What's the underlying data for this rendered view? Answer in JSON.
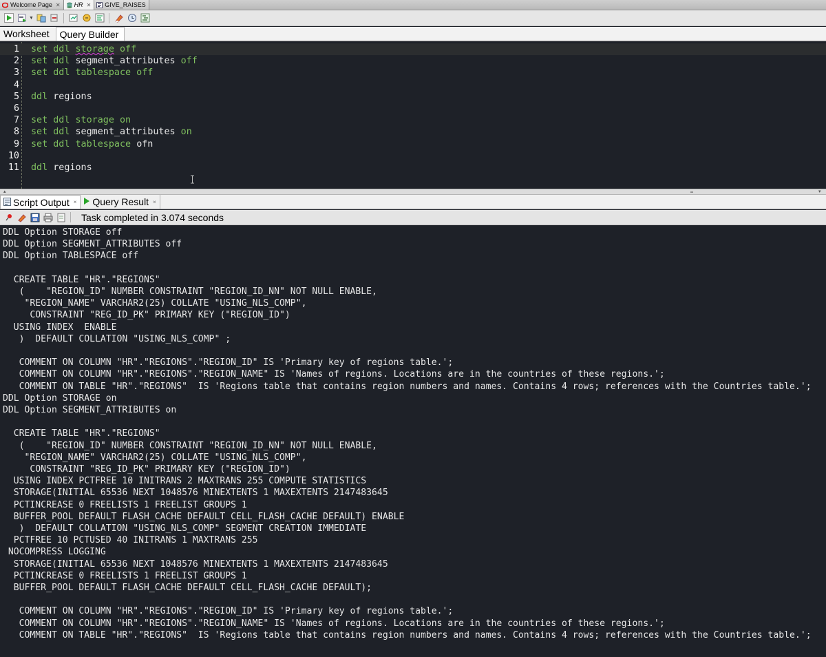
{
  "doc_tabs": [
    {
      "label": "Welcome Page",
      "icon": "oracle-icon",
      "italic": false,
      "active": false
    },
    {
      "label": "HR",
      "icon": "database-connection-icon",
      "italic": true,
      "active": true
    },
    {
      "label": "GIVE_RAISES",
      "icon": "procedure-icon",
      "italic": false,
      "active": false
    }
  ],
  "toolbar": {
    "buttons": [
      "run-statement-icon",
      "run-script-icon",
      "commit-icon",
      "rollback-icon",
      "tuning-icon",
      "autotrace-icon",
      "explain-plan-icon",
      "clear-icon",
      "history-icon",
      "format-icon"
    ]
  },
  "sub_tabs": {
    "worksheet": "Worksheet",
    "query_builder": "Query Builder"
  },
  "editor": {
    "lines": [
      {
        "n": "1",
        "parts": [
          [
            "kw",
            "set ddl "
          ],
          [
            "sq",
            "storage"
          ],
          [
            "kw",
            " off"
          ]
        ]
      },
      {
        "n": "2",
        "parts": [
          [
            "kw",
            "set ddl "
          ],
          [
            "id",
            "segment_attributes"
          ],
          [
            "kw",
            " off"
          ]
        ]
      },
      {
        "n": "3",
        "parts": [
          [
            "kw",
            "set ddl tablespace off"
          ]
        ]
      },
      {
        "n": "4",
        "parts": []
      },
      {
        "n": "5",
        "parts": [
          [
            "kw",
            "ddl "
          ],
          [
            "id",
            "regions"
          ]
        ]
      },
      {
        "n": "6",
        "parts": []
      },
      {
        "n": "7",
        "parts": [
          [
            "kw",
            "set ddl storage on"
          ]
        ]
      },
      {
        "n": "8",
        "parts": [
          [
            "kw",
            "set ddl "
          ],
          [
            "id",
            "segment_attributes"
          ],
          [
            "kw",
            " on"
          ]
        ]
      },
      {
        "n": "9",
        "parts": [
          [
            "kw",
            "set ddl tablespace "
          ],
          [
            "id",
            "ofn"
          ]
        ]
      },
      {
        "n": "10",
        "parts": []
      },
      {
        "n": "11",
        "parts": [
          [
            "kw",
            "ddl "
          ],
          [
            "id",
            "regions"
          ]
        ]
      }
    ]
  },
  "output_tabs": {
    "script_output": "Script Output",
    "query_result": "Query Result"
  },
  "status": "Task completed in 3.074 seconds",
  "output_lines": [
    "DDL Option STORAGE off",
    "DDL Option SEGMENT_ATTRIBUTES off",
    "DDL Option TABLESPACE off",
    "",
    "  CREATE TABLE \"HR\".\"REGIONS\"",
    "   (    \"REGION_ID\" NUMBER CONSTRAINT \"REGION_ID_NN\" NOT NULL ENABLE,",
    "    \"REGION_NAME\" VARCHAR2(25) COLLATE \"USING_NLS_COMP\",",
    "     CONSTRAINT \"REG_ID_PK\" PRIMARY KEY (\"REGION_ID\")",
    "  USING INDEX  ENABLE",
    "   )  DEFAULT COLLATION \"USING_NLS_COMP\" ;",
    "",
    "   COMMENT ON COLUMN \"HR\".\"REGIONS\".\"REGION_ID\" IS 'Primary key of regions table.';",
    "   COMMENT ON COLUMN \"HR\".\"REGIONS\".\"REGION_NAME\" IS 'Names of regions. Locations are in the countries of these regions.';",
    "   COMMENT ON TABLE \"HR\".\"REGIONS\"  IS 'Regions table that contains region numbers and names. Contains 4 rows; references with the Countries table.';",
    "DDL Option STORAGE on",
    "DDL Option SEGMENT_ATTRIBUTES on",
    "",
    "  CREATE TABLE \"HR\".\"REGIONS\"",
    "   (    \"REGION_ID\" NUMBER CONSTRAINT \"REGION_ID_NN\" NOT NULL ENABLE,",
    "    \"REGION_NAME\" VARCHAR2(25) COLLATE \"USING_NLS_COMP\",",
    "     CONSTRAINT \"REG_ID_PK\" PRIMARY KEY (\"REGION_ID\")",
    "  USING INDEX PCTFREE 10 INITRANS 2 MAXTRANS 255 COMPUTE STATISTICS",
    "  STORAGE(INITIAL 65536 NEXT 1048576 MINEXTENTS 1 MAXEXTENTS 2147483645",
    "  PCTINCREASE 0 FREELISTS 1 FREELIST GROUPS 1",
    "  BUFFER_POOL DEFAULT FLASH_CACHE DEFAULT CELL_FLASH_CACHE DEFAULT) ENABLE",
    "   )  DEFAULT COLLATION \"USING_NLS_COMP\" SEGMENT CREATION IMMEDIATE",
    "  PCTFREE 10 PCTUSED 40 INITRANS 1 MAXTRANS 255",
    " NOCOMPRESS LOGGING",
    "  STORAGE(INITIAL 65536 NEXT 1048576 MINEXTENTS 1 MAXEXTENTS 2147483645",
    "  PCTINCREASE 0 FREELISTS 1 FREELIST GROUPS 1",
    "  BUFFER_POOL DEFAULT FLASH_CACHE DEFAULT CELL_FLASH_CACHE DEFAULT);",
    "",
    "   COMMENT ON COLUMN \"HR\".\"REGIONS\".\"REGION_ID\" IS 'Primary key of regions table.';",
    "   COMMENT ON COLUMN \"HR\".\"REGIONS\".\"REGION_NAME\" IS 'Names of regions. Locations are in the countries of these regions.';",
    "   COMMENT ON TABLE \"HR\".\"REGIONS\"  IS 'Regions table that contains region numbers and names. Contains 4 rows; references with the Countries table.';"
  ],
  "colors": {
    "editor_bg": "#1e2128",
    "keyword": "#7fbf5f",
    "text": "#e6e6e6",
    "squiggle": "#d23cd6"
  }
}
